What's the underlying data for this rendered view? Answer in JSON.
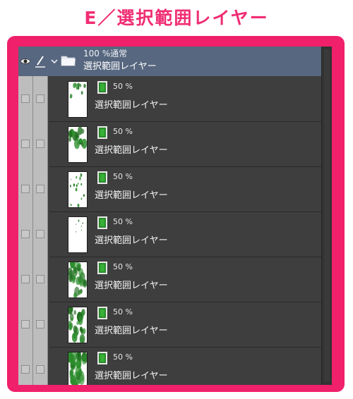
{
  "heading": "E／選択範囲レイヤー",
  "colors": {
    "accent": "#f0206a",
    "panel_bg": "#3e3e3e",
    "folder_row_bg": "#57677f",
    "mask_green": "#2b8a2b",
    "visibility_column": "#bdbdbd"
  },
  "layers_panel": {
    "folder": {
      "opacity": "100 %通常",
      "name": "選択範囲レイヤー",
      "icons": [
        "eye-icon",
        "pen-icon",
        "chevron-down-icon",
        "folder-icon"
      ]
    },
    "layers": [
      {
        "opacity": "50 %",
        "name": "選択範囲レイヤー",
        "thumbnail": "sparse-green-top"
      },
      {
        "opacity": "50 %",
        "name": "選択範囲レイヤー",
        "thumbnail": "green-upper-half"
      },
      {
        "opacity": "50 %",
        "name": "選択範囲レイヤー",
        "thumbnail": "scattered-green-dots"
      },
      {
        "opacity": "50 %",
        "name": "選択範囲レイヤー",
        "thumbnail": "faint-green-dots"
      },
      {
        "opacity": "50 %",
        "name": "選択範囲レイヤー",
        "thumbnail": "dense-green"
      },
      {
        "opacity": "50 %",
        "name": "選択範囲レイヤー",
        "thumbnail": "dense-green"
      },
      {
        "opacity": "50 %",
        "name": "選択範囲レイヤー",
        "thumbnail": "densest-green"
      }
    ]
  }
}
